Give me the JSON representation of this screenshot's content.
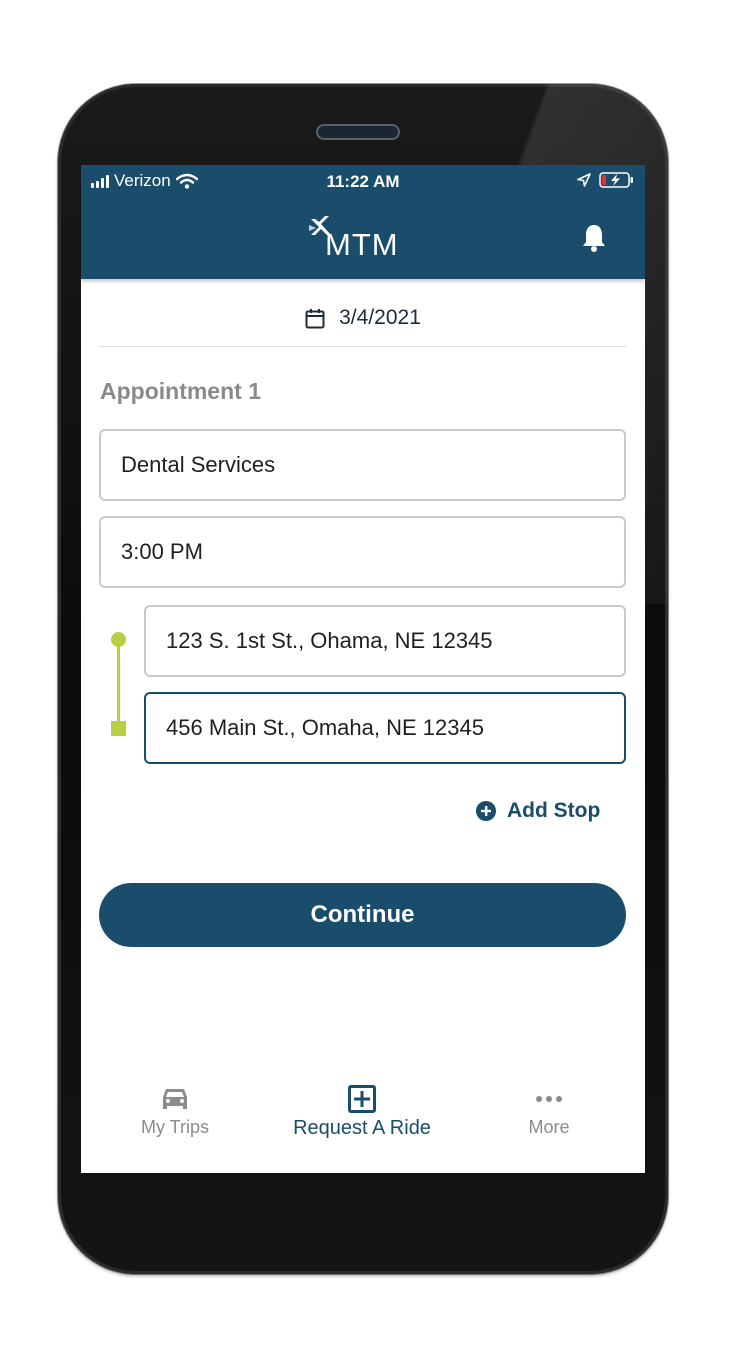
{
  "status_bar": {
    "carrier": "Verizon",
    "time": "11:22 AM"
  },
  "header": {
    "logo_text": "MTM",
    "icon": "bell-icon"
  },
  "date": {
    "value": "3/4/2021",
    "icon": "calendar-icon"
  },
  "appointment": {
    "title": "Appointment 1",
    "service": "Dental Services",
    "time": "3:00 PM",
    "pickup_address": "123 S. 1st St., Ohama, NE 12345",
    "dropoff_address": "456 Main St., Omaha, NE 12345"
  },
  "add_stop": {
    "label": "Add Stop",
    "icon": "plus-circle-icon"
  },
  "continue_button": {
    "label": "Continue"
  },
  "bottom_nav": [
    {
      "label": "My Trips",
      "icon": "car-icon",
      "active": false
    },
    {
      "label": "Request A Ride",
      "icon": "plus-square-icon",
      "active": true
    },
    {
      "label": "More",
      "icon": "more-icon",
      "active": false
    }
  ],
  "colors": {
    "primary": "#1a4d6b",
    "route_accent": "#b7cf42",
    "muted_text": "#8c8c8c",
    "field_border": "#c9c9c9"
  }
}
